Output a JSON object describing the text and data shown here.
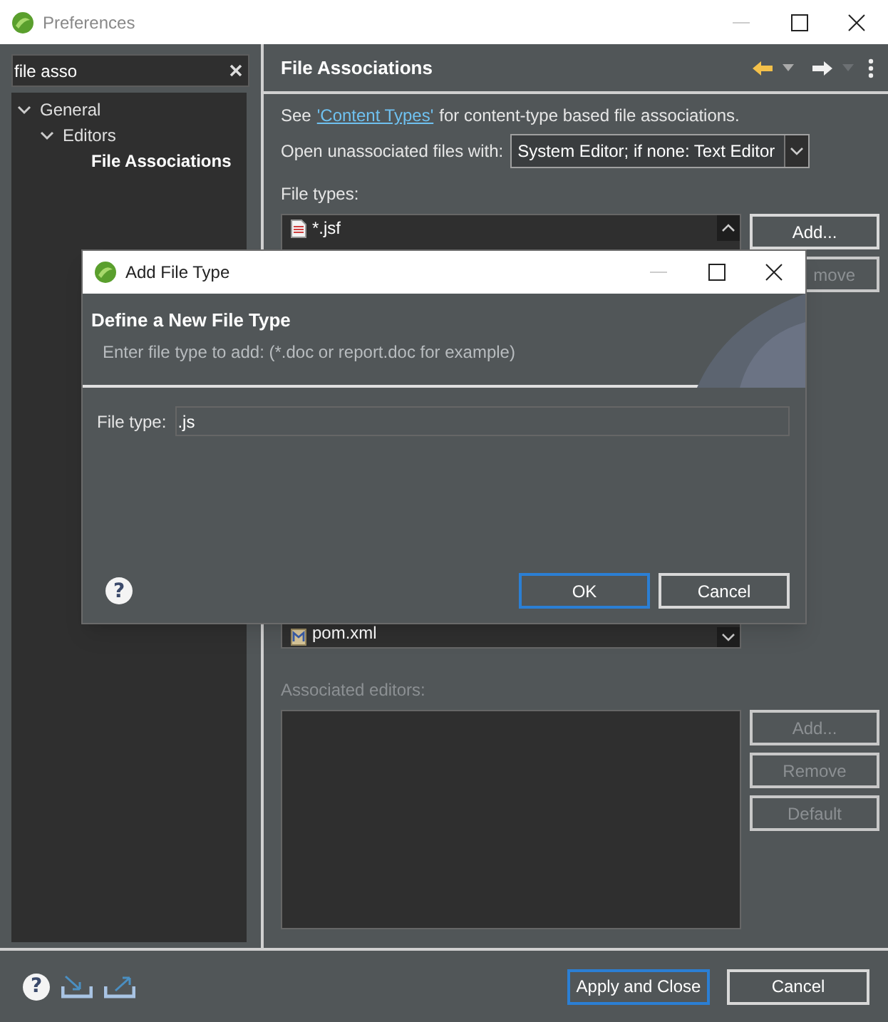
{
  "window": {
    "title": "Preferences"
  },
  "search": {
    "value": "file asso"
  },
  "tree": [
    {
      "label": "General",
      "expanded": true,
      "selected": false,
      "children": [
        {
          "label": "Editors",
          "expanded": true,
          "selected": false,
          "children": [
            {
              "label": "File Associations",
              "selected": true
            }
          ]
        }
      ]
    }
  ],
  "page": {
    "title": "File Associations",
    "intro": {
      "before": "See",
      "link": "'Content Types'",
      "after": "for content-type based file associations."
    },
    "open_with": {
      "label": "Open unassociated files with:",
      "value": "System Editor; if none: Text Editor"
    },
    "file_types": {
      "label": "File types:",
      "rows": [
        {
          "name": "*.jsf",
          "kind": "jsf"
        },
        {
          "name": "pom.xml",
          "kind": "xml"
        }
      ],
      "buttons": [
        {
          "label": "Add...",
          "disabled": false
        },
        {
          "label": "move",
          "disabled": true
        }
      ]
    },
    "editors": {
      "label": "Associated editors:",
      "disabled": true,
      "buttons": [
        {
          "label": "Add...",
          "disabled": true
        },
        {
          "label": "Remove",
          "disabled": true
        },
        {
          "label": "Default",
          "disabled": true
        }
      ]
    }
  },
  "footer": {
    "help_glyph": "?",
    "buttons": [
      {
        "label": "Apply and Close",
        "default": true
      },
      {
        "label": "Cancel",
        "default": false
      }
    ]
  },
  "dialog": {
    "title": "Add File Type",
    "heading": "Define a New File Type",
    "message": "Enter file type to add: (*.doc or report.doc for example)",
    "field_label": "File type:",
    "field_value": ".js",
    "help_glyph": "?",
    "buttons": [
      {
        "label": "OK",
        "default": true
      },
      {
        "label": "Cancel",
        "default": false
      }
    ]
  }
}
